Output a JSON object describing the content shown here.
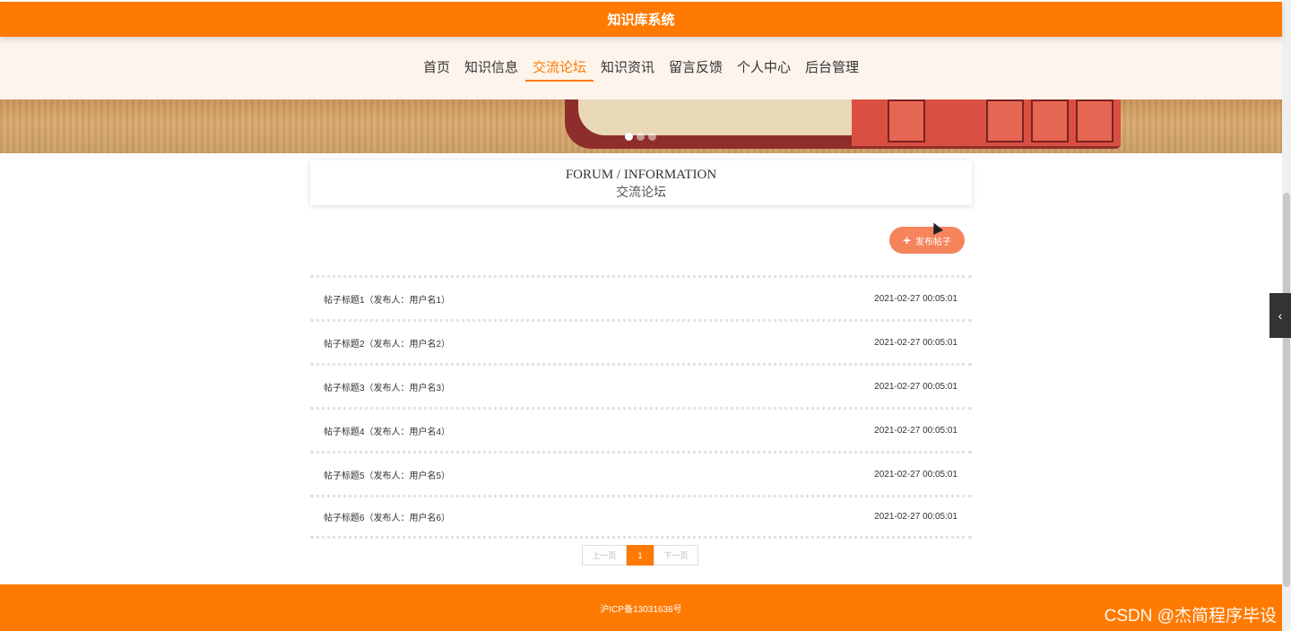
{
  "header": {
    "title": "知识库系统"
  },
  "nav": {
    "items": [
      {
        "label": "首页"
      },
      {
        "label": "知识信息"
      },
      {
        "label": "交流论坛",
        "active": true
      },
      {
        "label": "知识资讯"
      },
      {
        "label": "留言反馈"
      },
      {
        "label": "个人中心"
      },
      {
        "label": "后台管理"
      }
    ]
  },
  "banner": {
    "slides": 3,
    "active_slide": 1
  },
  "section": {
    "title_en": "FORUM / INFORMATION",
    "title_cn": "交流论坛"
  },
  "actions": {
    "publish_label": "发布帖子",
    "publish_icon": "plus-icon"
  },
  "posts": [
    {
      "title": "帖子标题1（发布人：用户名1）",
      "time": "2021-02-27 00:05:01"
    },
    {
      "title": "帖子标题2（发布人：用户名2）",
      "time": "2021-02-27 00:05:01"
    },
    {
      "title": "帖子标题3（发布人：用户名3）",
      "time": "2021-02-27 00:05:01"
    },
    {
      "title": "帖子标题4（发布人：用户名4）",
      "time": "2021-02-27 00:05:01"
    },
    {
      "title": "帖子标题5（发布人：用户名5）",
      "time": "2021-02-27 00:05:01"
    },
    {
      "title": "帖子标题6（发布人：用户名6）",
      "time": "2021-02-27 00:05:01"
    }
  ],
  "pagination": {
    "prev_label": "上一页",
    "current": "1",
    "next_label": "下一页"
  },
  "footer": {
    "icp": "沪ICP备13031638号"
  },
  "watermark": {
    "text": "CSDN @杰简程序毕设"
  },
  "side_toggle": {
    "icon": "chevron-left-icon",
    "glyph": "‹"
  },
  "colors": {
    "primary": "#ff7a00",
    "nav_bg": "#fdf4ec",
    "publish_button": "#f5845c"
  }
}
